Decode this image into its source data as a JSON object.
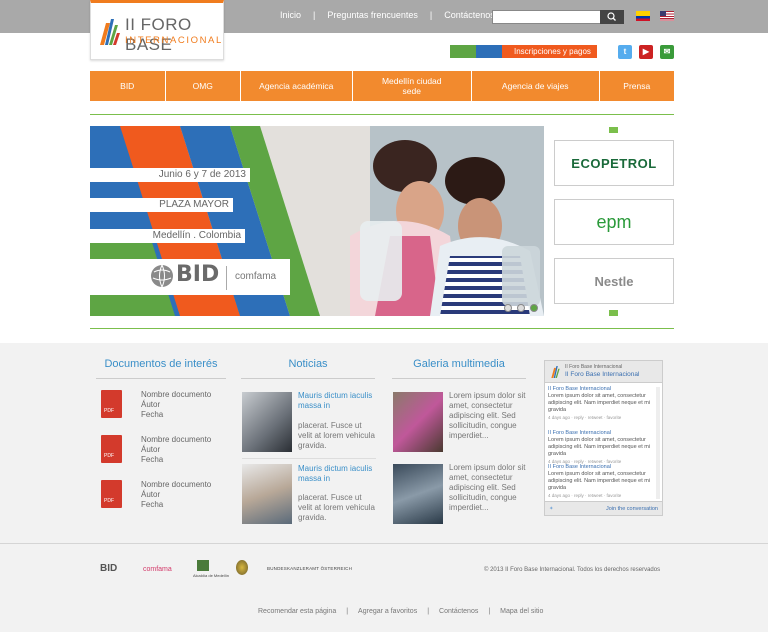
{
  "site": {
    "title": "II FORO BASE",
    "subtitle": "INTERNACIONAL"
  },
  "topnav": [
    "Inicio",
    "Preguntas frencuentes",
    "Contáctenos"
  ],
  "search": {
    "placeholder": ""
  },
  "registration": {
    "label": "Inscripciones y pagos"
  },
  "mainnav": [
    {
      "label": "BID"
    },
    {
      "label": "OMG"
    },
    {
      "label": "Agencia académica"
    },
    {
      "label": "Medellín ciudad sede"
    },
    {
      "label": "Agencia de viajes"
    },
    {
      "label": "Prensa"
    }
  ],
  "slide": {
    "date": "Junio 6 y 7 de 2013",
    "venue": "PLAZA MAYOR",
    "city": "Medellín . Colombia",
    "logo_a": "BID",
    "logo_b": "comfama"
  },
  "sponsors": [
    "ECOPETROL",
    "epm",
    "Nestle"
  ],
  "sections": {
    "docs": "Documentos de interés",
    "news": "Noticias",
    "gallery": "Galeria multimedia"
  },
  "documents": [
    {
      "name": "Nombre documento",
      "author": "Áutor",
      "date": "Fecha"
    },
    {
      "name": "Nombre documento",
      "author": "Áutor",
      "date": "Fecha"
    },
    {
      "name": "Nombre documento",
      "author": "Áutor",
      "date": "Fecha"
    }
  ],
  "news": [
    {
      "title": "Mauris dictum iaculis massa in",
      "body": "placerat. Fusce ut velit at lorem vehicula gravida."
    },
    {
      "title": "Mauris dictum iaculis massa in",
      "body": "placerat. Fusce ut velit at lorem vehicula gravida."
    }
  ],
  "gallery": [
    {
      "text": "Lorem ipsum dolor sit amet, consectetur adipiscing elit. Sed sollicitudin, congue imperdiet..."
    },
    {
      "text": "Lorem ipsum dolor sit amet, consectetur adipiscing elit. Sed sollicitudin, congue imperdiet..."
    }
  ],
  "twitter": {
    "account_small": "II Foro Base Internacional",
    "account": "II Foro Base Internacional",
    "tweets": [
      {
        "who": "II Foro Base Internacional",
        "text": "Lorem ipsum dolor sit amet, consectetur adipiscing elit. Nam imperdiet neque et mi gravida",
        "meta": "4 days ago · reply · retweet · favorite"
      },
      {
        "who": "II Foro Base Internacional",
        "text": "Lorem ipsum dolor sit amet, consectetur adipiscing elit. Nam imperdiet neque et mi gravida",
        "meta": "4 days ago · reply · retweet · favorite"
      },
      {
        "who": "II Foro Base Internacional",
        "text": "Lorem ipsum dolor sit amet, consectetur adipiscing elit. Nam imperdiet neque et mi gravida",
        "meta": "4 days ago · reply · retweet · favorite"
      }
    ],
    "join": "Join the conversation"
  },
  "partners": [
    "BID",
    "comfama",
    "Alcaldía de Medellín",
    "",
    "BUNDESKANZLERAMT ÖSTERREICH"
  ],
  "copyright": "© 2013  II Foro Base Internacional. Todos los derechos reservados",
  "footnav": [
    "Recomendar esta página",
    "Agregar a favoritos",
    "Contáctenos",
    "Mapa del sitio"
  ],
  "colors": {
    "orange": "#f28a2e",
    "green": "#7bbf4c",
    "blue": "#3a8fc8"
  }
}
